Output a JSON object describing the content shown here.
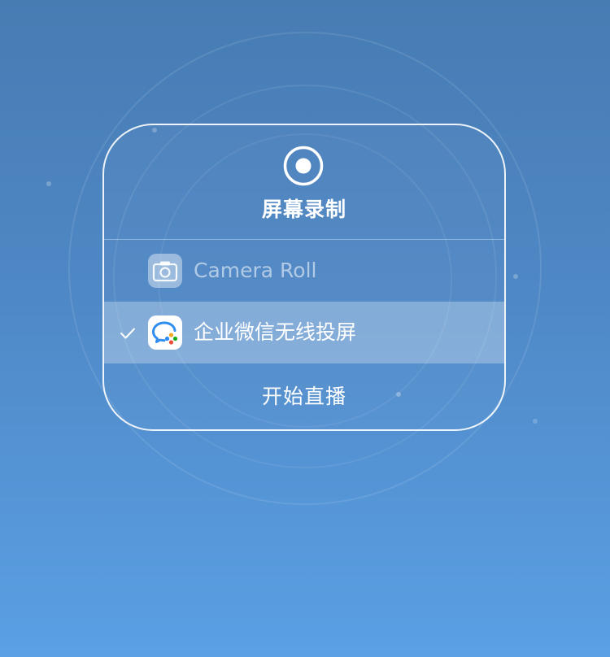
{
  "dialog": {
    "title": "屏幕录制",
    "icon": "record-icon",
    "options": [
      {
        "label": "Camera Roll",
        "icon": "camera-icon",
        "selected": false
      },
      {
        "label": "企业微信无线投屏",
        "icon": "wecom-app-icon",
        "selected": true
      }
    ],
    "start_label": "开始直播",
    "check_icon": "checkmark-icon"
  },
  "colors": {
    "background_top": "#477cb3",
    "background_bottom": "#5aa0e4",
    "text": "#ffffff"
  }
}
